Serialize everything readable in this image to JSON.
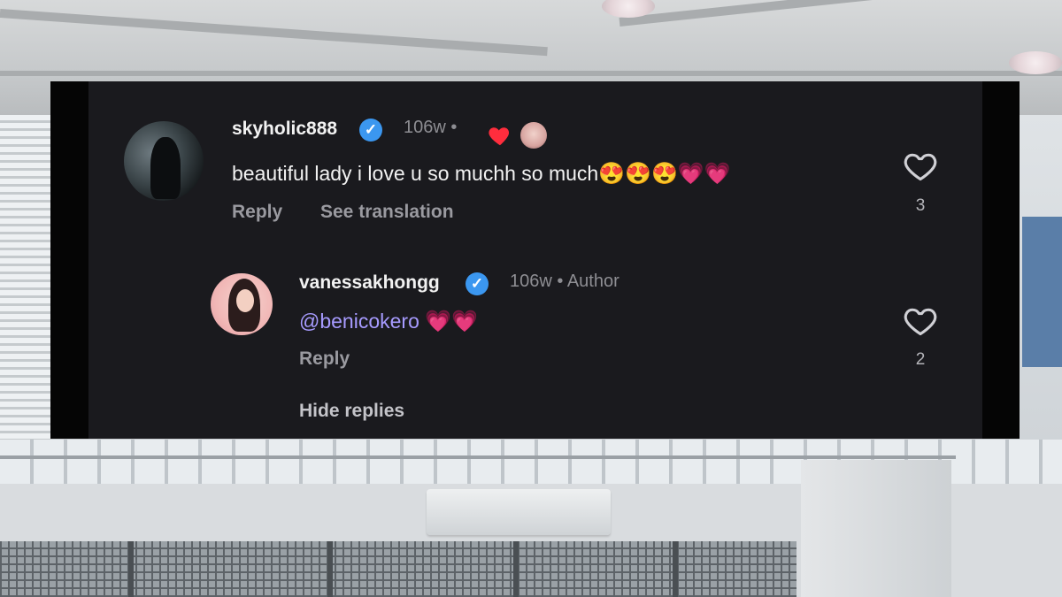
{
  "comment": {
    "username": "skyholic888",
    "time": "106w",
    "text": "beautiful lady i love u so muchh so much",
    "emojis": [
      "😍",
      "😍",
      "😍",
      "💗",
      "💗"
    ],
    "reply_label": "Reply",
    "translate_label": "See translation",
    "like_count": "3"
  },
  "reply": {
    "username": "vanessakhongg",
    "time": "106w",
    "author_label": "Author",
    "mention": "@benicokero",
    "emojis": [
      "💗",
      "💗"
    ],
    "reply_label": "Reply",
    "like_count": "2"
  },
  "hide_replies_label": "Hide replies",
  "colors": {
    "panel_background": "#1a1a1e",
    "verified_badge": "#3b97f0",
    "mention": "#a79bff",
    "reaction_heart": "#ff2d3d",
    "emoji_heart": "#ff3c7a"
  },
  "icons": [
    "verified-badge-icon",
    "heart-outline-icon",
    "reaction-heart-icon"
  ]
}
